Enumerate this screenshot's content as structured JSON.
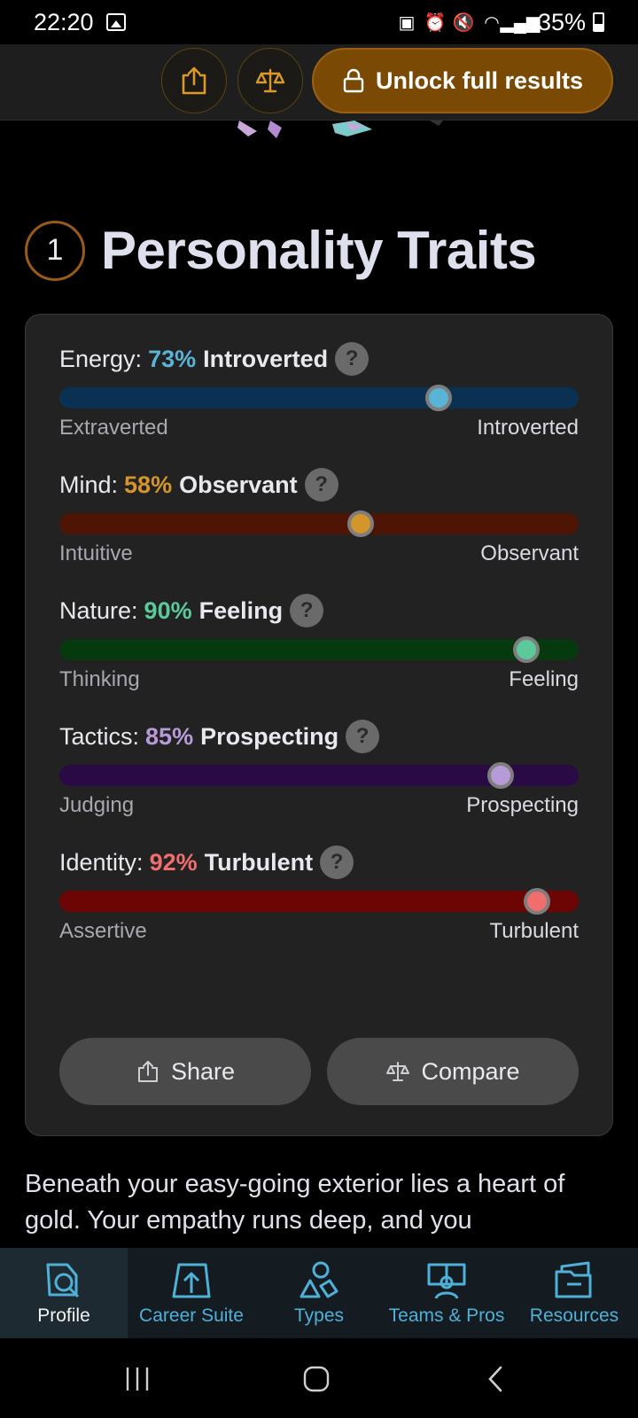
{
  "status_bar": {
    "time": "22:20",
    "battery": "35%"
  },
  "top_bar": {
    "unlock_label": "Unlock full results",
    "accent": "#d99a2b"
  },
  "section": {
    "number": "1",
    "title": "Personality Traits"
  },
  "traits": [
    {
      "label": "Energy:",
      "percent": "73%",
      "result": "Introverted",
      "value": 0.73,
      "left_pole": "Extraverted",
      "right_pole": "Introverted",
      "color": "#5ab4d6",
      "track": "#0a3152"
    },
    {
      "label": "Mind:",
      "percent": "58%",
      "result": "Observant",
      "value": 0.58,
      "left_pole": "Intuitive",
      "right_pole": "Observant",
      "color": "#d4952a",
      "track": "#4e1505"
    },
    {
      "label": "Nature:",
      "percent": "90%",
      "result": "Feeling",
      "value": 0.9,
      "left_pole": "Thinking",
      "right_pole": "Feeling",
      "color": "#5cc99b",
      "track": "#063a0e"
    },
    {
      "label": "Tactics:",
      "percent": "85%",
      "result": "Prospecting",
      "value": 0.85,
      "left_pole": "Judging",
      "right_pole": "Prospecting",
      "color": "#b79ad8",
      "track": "#2a0a44"
    },
    {
      "label": "Identity:",
      "percent": "92%",
      "result": "Turbulent",
      "value": 0.92,
      "left_pole": "Assertive",
      "right_pole": "Turbulent",
      "color": "#f06e6e",
      "track": "#6e0505"
    }
  ],
  "card_buttons": {
    "share": "Share",
    "compare": "Compare"
  },
  "description": "Beneath your easy-going exterior lies a heart of gold. Your empathy runs deep, and you",
  "bottom_nav": [
    {
      "label": "Profile",
      "icon": "profile-icon",
      "active": true
    },
    {
      "label": "Career Suite",
      "icon": "career-suite-icon",
      "active": false
    },
    {
      "label": "Types",
      "icon": "types-icon",
      "active": false
    },
    {
      "label": "Teams & Pros",
      "icon": "teams-icon",
      "active": false
    },
    {
      "label": "Resources",
      "icon": "resources-icon",
      "active": false
    }
  ]
}
